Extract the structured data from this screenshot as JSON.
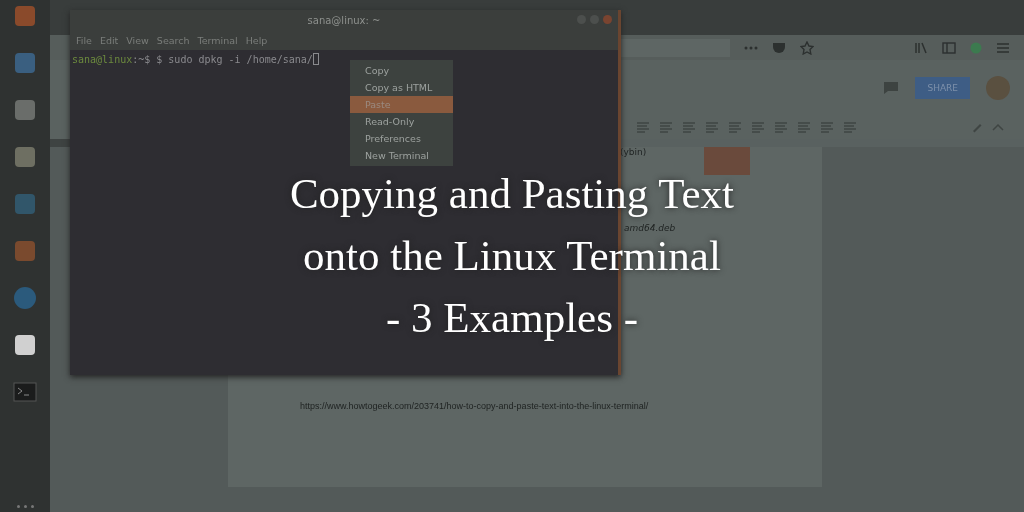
{
  "terminal": {
    "title": "sana@linux: ~",
    "menu": [
      "File",
      "Edit",
      "View",
      "Search",
      "Terminal",
      "Help"
    ],
    "prompt_user": "sana@linux",
    "prompt_rest": ":~$ $ sudo dpkg -i /home/sana/",
    "context_menu": [
      {
        "label": "Copy",
        "selected": false
      },
      {
        "label": "Copy as HTML",
        "selected": false
      },
      {
        "label": "Paste",
        "selected": true
      },
      {
        "label": "Read-Only",
        "selected": false
      },
      {
        "label": "Preferences",
        "selected": false
      },
      {
        "label": "New Terminal",
        "selected": false
      }
    ]
  },
  "browser": {
    "share_button": "SHARE",
    "doc_fragments": [
      "(ybin)",
      "amd64.deb"
    ],
    "link": "https://www.howtogeek.com/203741/how-to-copy-and-paste-text-into-the-linux-terminal/"
  },
  "title": {
    "lines": [
      "Copying and Pasting Text",
      "onto the Linux Terminal",
      "- 3 Examples -"
    ]
  }
}
